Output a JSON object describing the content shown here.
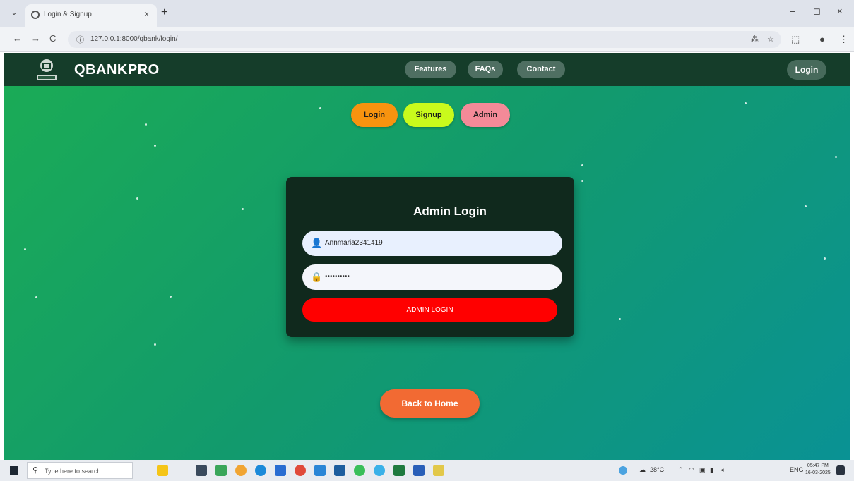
{
  "browser": {
    "tab_title": "Login & Signup",
    "tab_close": "×",
    "new_tab": "+",
    "tab_list": "⌄",
    "url": "127.0.0.1:8000/qbank/login/",
    "translate_icon": "⁂",
    "star_icon": "☆",
    "back": "←",
    "forward": "→",
    "reload": "C",
    "info": "ⓘ",
    "minimize": "–",
    "maximize": "◻",
    "close": "×"
  },
  "navbar": {
    "brand": "QBANKPRO",
    "links": [
      "Features",
      "FAQs",
      "Contact"
    ],
    "login": "Login"
  },
  "auth_switch": {
    "login": "Login",
    "signup": "Signup",
    "admin": "Admin"
  },
  "colors": {
    "login_btn": "#f7930f",
    "signup_btn": "#c9fa1c",
    "admin_btn": "#f48a98",
    "submit": "#ff0000",
    "back_home": "#f26a33"
  },
  "admin_form": {
    "title": "Admin Login",
    "username_value": "Annmaria2341419",
    "password_value": "••••••••••",
    "username_icon": "user-icon",
    "password_icon": "lock-icon",
    "submit": "ADMIN LOGIN"
  },
  "back_home": "Back to Home",
  "taskbar": {
    "search_placeholder": "Type here to search",
    "temperature": "28°C",
    "language": "ENG",
    "time": "05:47 PM",
    "date": "16-03-2025"
  }
}
